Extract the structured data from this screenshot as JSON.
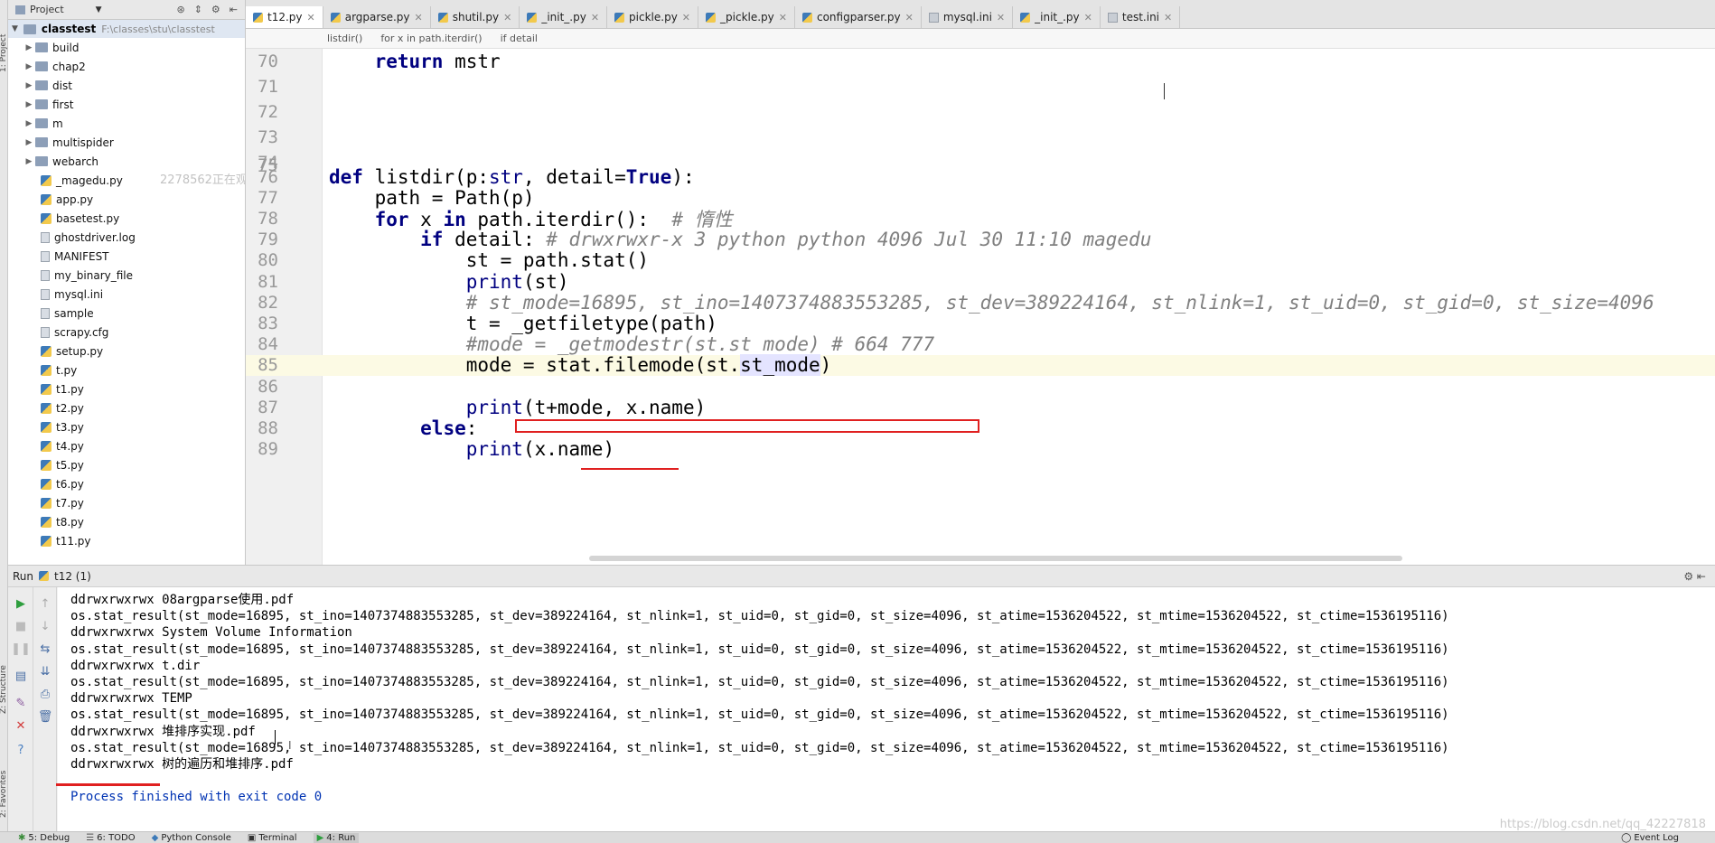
{
  "left_strip": {
    "labels": [
      "1: Project",
      "Z: Structure",
      "2: Favorites"
    ]
  },
  "project": {
    "title": "Project",
    "root_name": "classtest",
    "root_path": "F:\\classes\\stu\\classtest",
    "folders": [
      "build",
      "chap2",
      "dist",
      "first",
      "m",
      "multispider",
      "webarch"
    ],
    "files": [
      {
        "name": "_magedu.py",
        "type": "py"
      },
      {
        "name": "app.py",
        "type": "py"
      },
      {
        "name": "basetest.py",
        "type": "py"
      },
      {
        "name": "ghostdriver.log",
        "type": "txt"
      },
      {
        "name": "MANIFEST",
        "type": "txt"
      },
      {
        "name": "my_binary_file",
        "type": "txt"
      },
      {
        "name": "mysql.ini",
        "type": "txt"
      },
      {
        "name": "sample",
        "type": "txt"
      },
      {
        "name": "scrapy.cfg",
        "type": "txt"
      },
      {
        "name": "setup.py",
        "type": "py"
      },
      {
        "name": "t.py",
        "type": "py"
      },
      {
        "name": "t1.py",
        "type": "py"
      },
      {
        "name": "t2.py",
        "type": "py"
      },
      {
        "name": "t3.py",
        "type": "py"
      },
      {
        "name": "t4.py",
        "type": "py"
      },
      {
        "name": "t5.py",
        "type": "py"
      },
      {
        "name": "t6.py",
        "type": "py"
      },
      {
        "name": "t7.py",
        "type": "py"
      },
      {
        "name": "t8.py",
        "type": "py"
      },
      {
        "name": "t11.py",
        "type": "py"
      }
    ],
    "watermark": "2278562正在观看视频"
  },
  "tabs": [
    {
      "label": "t12.py",
      "active": true
    },
    {
      "label": "argparse.py"
    },
    {
      "label": "shutil.py"
    },
    {
      "label": "_init_.py"
    },
    {
      "label": "pickle.py"
    },
    {
      "label": "_pickle.py"
    },
    {
      "label": "configparser.py"
    },
    {
      "label": "mysql.ini"
    },
    {
      "label": "_init_.py"
    },
    {
      "label": "test.ini"
    }
  ],
  "breadcrumb": [
    "listdir()",
    "for x in path.iterdir()",
    "if detail"
  ],
  "editor": {
    "lines": [
      {
        "n": "70",
        "code": "    return mstr"
      },
      {
        "n": "71",
        "code": ""
      },
      {
        "n": "72",
        "code": ""
      },
      {
        "n": "73",
        "code": ""
      },
      {
        "n": "74",
        "code": ""
      },
      {
        "n": "75",
        "code": ""
      },
      {
        "n": "76",
        "code": "def listdir(p:str, detail=True):"
      },
      {
        "n": "77",
        "code": "    path = Path(p)"
      },
      {
        "n": "78",
        "code": "    for x in path.iterdir():  # 惰性"
      },
      {
        "n": "79",
        "code": "        if detail: # drwxrwxr-x 3 python python 4096 Jul 30 11:10 magedu"
      },
      {
        "n": "80",
        "code": "            st = path.stat()"
      },
      {
        "n": "81",
        "code": "            print(st)"
      },
      {
        "n": "82",
        "code": "            # st_mode=16895, st_ino=1407374883553285, st_dev=389224164, st_nlink=1, st_uid=0, st_gid=0, st_size=4096"
      },
      {
        "n": "83",
        "code": "            t = _getfiletype(path)"
      },
      {
        "n": "84",
        "code": "            #mode = _getmodestr(st.st_mode) # 664 777"
      },
      {
        "n": "85",
        "code": "            mode = stat.filemode(st.st_mode)"
      },
      {
        "n": "86",
        "code": ""
      },
      {
        "n": "87",
        "code": "            print(t+mode, x.name)"
      },
      {
        "n": "88",
        "code": "        else:"
      },
      {
        "n": "89",
        "code": "            print(x.name)"
      }
    ]
  },
  "run": {
    "title": "Run",
    "config": "t12 (1)",
    "output": [
      "ddrwxrwxrwx 08argparse使用.pdf",
      "os.stat_result(st_mode=16895, st_ino=1407374883553285, st_dev=389224164, st_nlink=1, st_uid=0, st_gid=0, st_size=4096, st_atime=1536204522, st_mtime=1536204522, st_ctime=1536195116)",
      "ddrwxrwxrwx System Volume Information",
      "os.stat_result(st_mode=16895, st_ino=1407374883553285, st_dev=389224164, st_nlink=1, st_uid=0, st_gid=0, st_size=4096, st_atime=1536204522, st_mtime=1536204522, st_ctime=1536195116)",
      "ddrwxrwxrwx t.dir",
      "os.stat_result(st_mode=16895, st_ino=1407374883553285, st_dev=389224164, st_nlink=1, st_uid=0, st_gid=0, st_size=4096, st_atime=1536204522, st_mtime=1536204522, st_ctime=1536195116)",
      "ddrwxrwxrwx TEMP",
      "os.stat_result(st_mode=16895, st_ino=1407374883553285, st_dev=389224164, st_nlink=1, st_uid=0, st_gid=0, st_size=4096, st_atime=1536204522, st_mtime=1536204522, st_ctime=1536195116)",
      "ddrwxrwxrwx 堆排序实现.pdf",
      "os.stat_result(st_mode=16895, st_ino=1407374883553285, st_dev=389224164, st_nlink=1, st_uid=0, st_gid=0, st_size=4096, st_atime=1536204522, st_mtime=1536204522, st_ctime=1536195116)",
      "ddrwxrwxrwx 树的遍历和堆排序.pdf",
      "",
      "Process finished with exit code 0"
    ],
    "watermark": "https://blog.csdn.net/qq_42227818"
  },
  "statusbar": {
    "items": [
      "5: Debug",
      "6: TODO",
      "Python Console",
      "Terminal",
      "4: Run"
    ],
    "event_log": "Event Log"
  },
  "colors": {
    "annotation": "#e02020",
    "keyword": "#000080",
    "comment": "#808080"
  }
}
